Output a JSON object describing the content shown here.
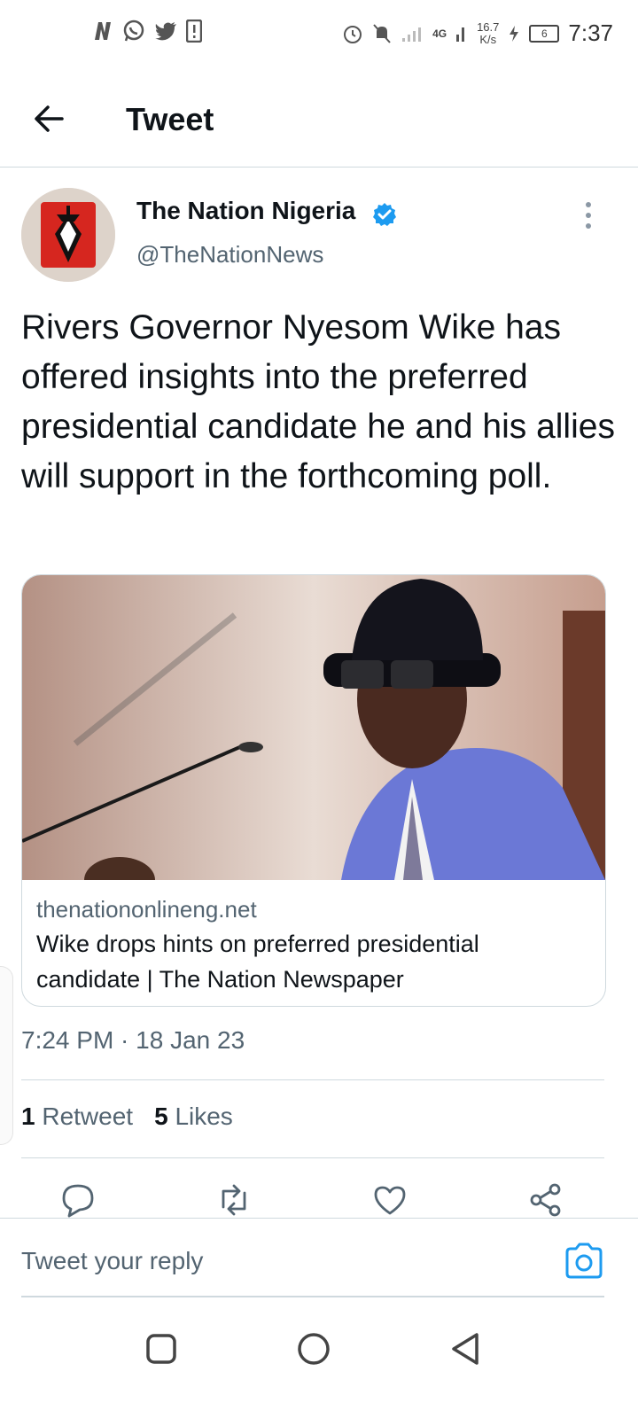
{
  "status_bar": {
    "left_icons": [
      "netflix-icon",
      "whatsapp-icon",
      "twitter-icon",
      "alert-icon"
    ],
    "network": "4G",
    "speed_value": "16.7",
    "speed_unit": "K/s",
    "battery": "6",
    "time": "7:37"
  },
  "header": {
    "title": "Tweet"
  },
  "tweet": {
    "author_name": "The Nation Nigeria",
    "handle": "@TheNationNews",
    "text": "Rivers Governor Nyesom Wike has offered insights into the preferred presidential candidate he and his allies will support in the forthcoming poll.",
    "card": {
      "domain": "thenationonlineng.net",
      "title": "Wike drops hints on preferred presidential candidate | The Nation Newspaper"
    },
    "timestamp": "7:24 PM · 18 Jan 23",
    "stats": {
      "retweets_count": "1",
      "retweets_label": "Retweet",
      "likes_count": "5",
      "likes_label": "Likes"
    }
  },
  "reply": {
    "placeholder": "Tweet your reply"
  },
  "colors": {
    "accent": "#1d9bf0",
    "text_primary": "#0f1419",
    "text_secondary": "#536471",
    "border": "#cfd9de"
  }
}
